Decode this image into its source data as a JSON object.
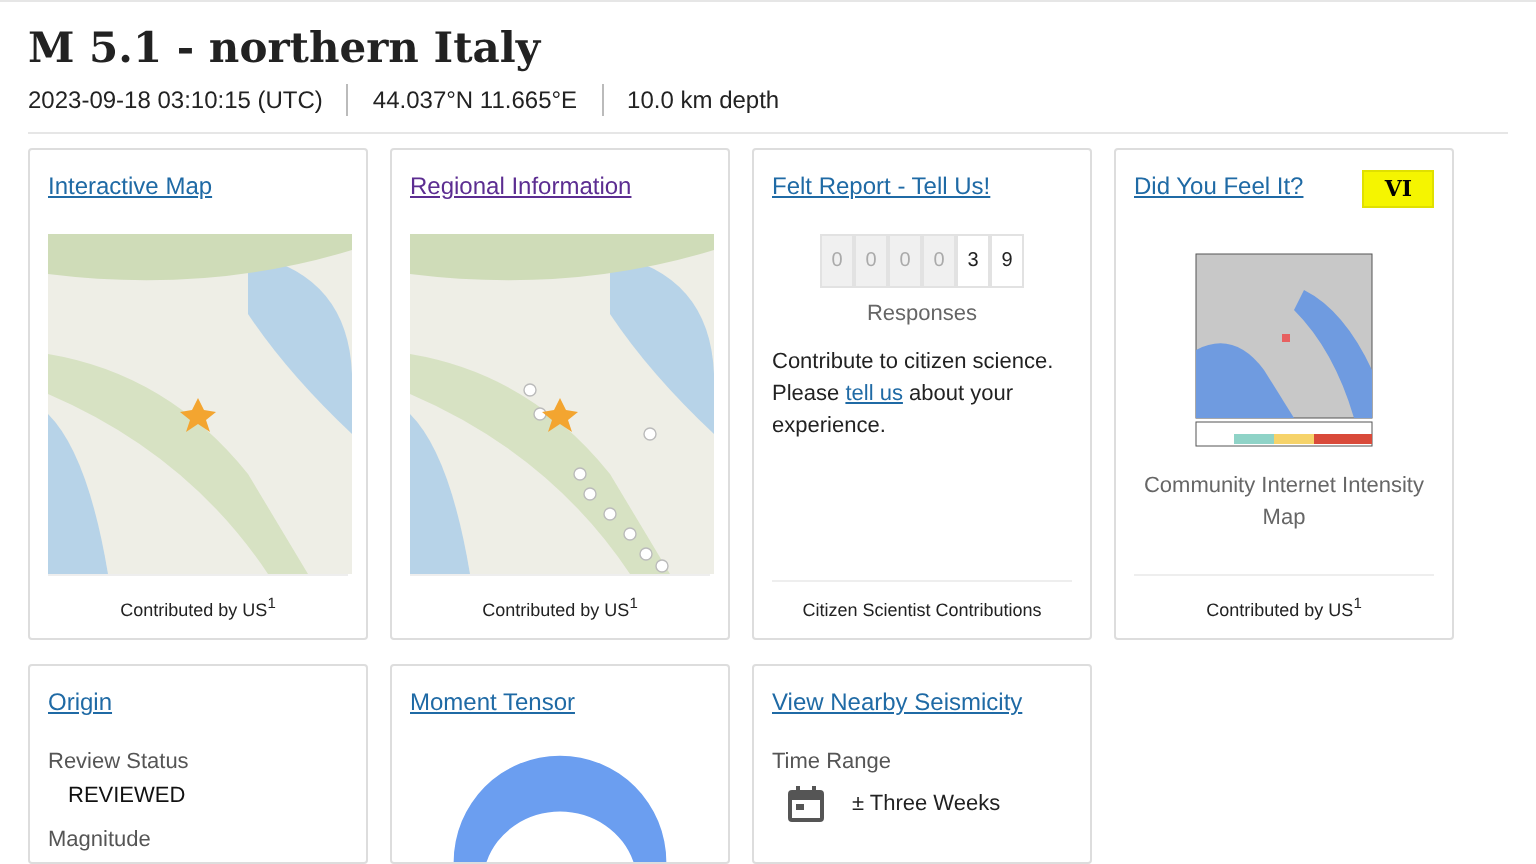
{
  "event": {
    "title": "M 5.1 - northern Italy",
    "time": "2023-09-18 03:10:15 (UTC)",
    "location": "44.037°N 11.665°E",
    "depth": "10.0 km depth"
  },
  "cards": [
    {
      "kind": "map",
      "title": "Interactive Map",
      "visited": false,
      "seismicity": false,
      "footer": "Contributed by US$^{1}$"
    },
    {
      "kind": "map",
      "title": "Regional Information",
      "visited": true,
      "seismicity": true,
      "footer": "Contributed by US$^{1}$"
    },
    {
      "kind": "felt",
      "title": "Felt Report - Tell Us!",
      "visited": false,
      "digits": [
        {
          "value": "0",
          "dim": true
        },
        {
          "value": "0",
          "dim": true
        },
        {
          "value": "0",
          "dim": true
        },
        {
          "value": "0",
          "dim": true
        },
        {
          "value": "3",
          "dim": false
        },
        {
          "value": "9",
          "dim": false
        }
      ],
      "counter_label": "Responses",
      "text_before": "Contribute to citizen science. Please",
      "link": "tell us",
      "text_after": "about your experience.",
      "footer": "Citizen Scientist Contributions"
    },
    {
      "kind": "dyfi",
      "title": "Did You Feel It?",
      "visited": false,
      "badge": "VI",
      "caption": "Community Internet Intensity Map",
      "footer": "Contributed by US$^{1}$"
    },
    {
      "kind": "origin",
      "title": "Origin",
      "visited": false,
      "label": "Review Status",
      "value": "REVIEWED",
      "label_2": "Magnitude"
    },
    {
      "kind": "tensor",
      "title": "Moment Tensor",
      "visited": false
    },
    {
      "kind": "nearby",
      "title": "View Nearby Seismicity",
      "visited": false,
      "label": "Time Range",
      "value": "± Three Weeks"
    }
  ]
}
